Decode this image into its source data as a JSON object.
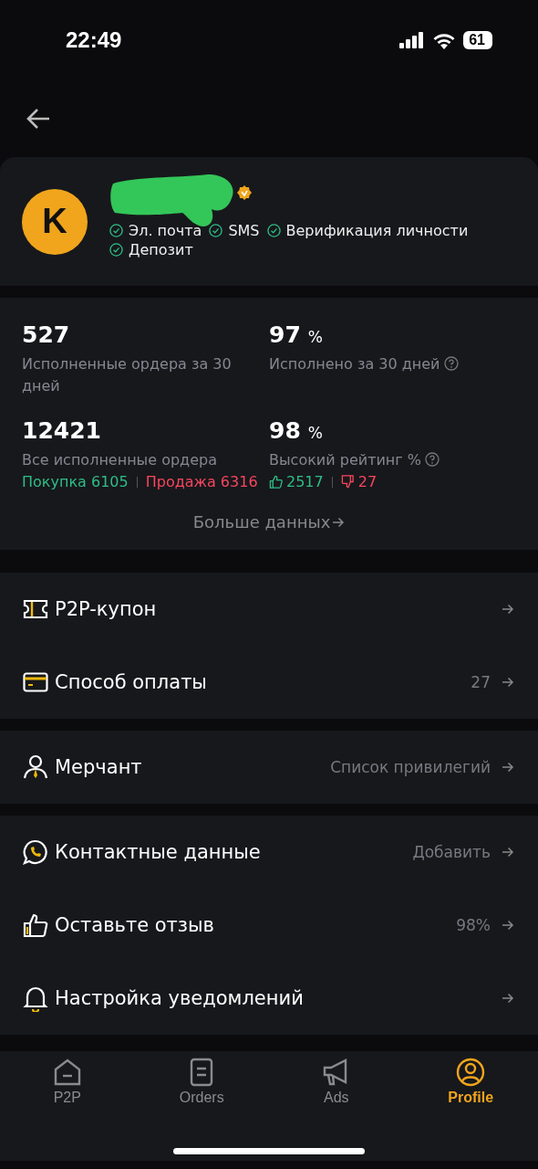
{
  "status_bar": {
    "time": "22:49",
    "battery": "61"
  },
  "profile": {
    "avatar_letter": "K",
    "verified": true,
    "verifications": [
      {
        "label": "Эл. почта",
        "verified": true
      },
      {
        "label": "SMS",
        "verified": true
      },
      {
        "label": "Верификация личности",
        "verified": true
      },
      {
        "label": "Депозит",
        "verified": true
      }
    ]
  },
  "stats": [
    {
      "value": "527",
      "label": "Исполненные ордера за 30 дней"
    },
    {
      "value": "97",
      "unit": "%",
      "label": "Исполнено за 30 дней",
      "help": true
    },
    {
      "value": "12421",
      "label": "Все исполненные ордера",
      "buy": "Покупка 6105",
      "sell": "Продажа 6316"
    },
    {
      "value": "98",
      "unit": "%",
      "label": "Высокий рейтинг %",
      "help": true,
      "likes": "2517",
      "dislikes": "27"
    }
  ],
  "more_link": "Больше данных",
  "menu_groups": [
    [
      {
        "kind": "coupon",
        "label": "P2P-купон"
      },
      {
        "kind": "card",
        "label": "Способ оплаты",
        "value": "27"
      }
    ],
    [
      {
        "kind": "merchant",
        "label": "Мерчант",
        "value": "Список привилегий"
      }
    ],
    [
      {
        "kind": "contact",
        "label": "Контактные данные",
        "value": "Добавить"
      },
      {
        "kind": "review",
        "label": "Оставьте отзыв",
        "value": "98%"
      },
      {
        "kind": "bell",
        "label": "Настройка уведомлений"
      }
    ]
  ],
  "tabs": [
    {
      "label": "P2P",
      "selected": false
    },
    {
      "label": "Orders",
      "selected": false
    },
    {
      "label": "Ads",
      "selected": false
    },
    {
      "label": "Profile",
      "selected": true
    }
  ]
}
